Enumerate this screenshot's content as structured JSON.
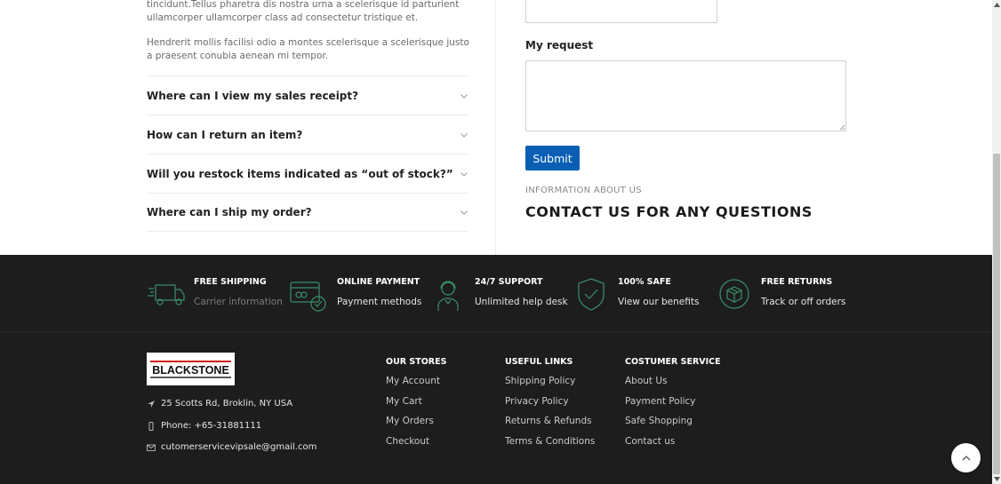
{
  "intro": {
    "paragraph_1": "tincidunt.Tellus pharetra dis nostra urna a scelerisque id parturient ullamcorper ullamcorper class ad consectetur tristique et.",
    "paragraph_2": "Hendrerit mollis facilisi odio a montes scelerisque a scelerisque justo a praesent conubia aenean mi tempor."
  },
  "faq": [
    {
      "question": "Where can I view my sales receipt?"
    },
    {
      "question": "How can I return an item?"
    },
    {
      "question": "Will you restock items indicated as “out of stock?”"
    },
    {
      "question": "Where can I ship my order?"
    }
  ],
  "form": {
    "top_field_value": "",
    "request_label": "My request",
    "request_value": "",
    "submit_label": "Submit",
    "info_label": "INFORMATION ABOUT US",
    "contact_heading": "CONTACT US FOR ANY QUESTIONS"
  },
  "features": [
    {
      "icon": "truck-icon",
      "title": "FREE SHIPPING",
      "subtitle": "Carrier information"
    },
    {
      "icon": "payment-card-icon",
      "title": "ONLINE PAYMENT",
      "subtitle": "Payment methods"
    },
    {
      "icon": "support-agent-icon",
      "title": "24/7 SUPPORT",
      "subtitle": "Unlimited help desk"
    },
    {
      "icon": "shield-check-icon",
      "title": "100% SAFE",
      "subtitle": "View our benefits"
    },
    {
      "icon": "box-return-icon",
      "title": "FREE RETURNS",
      "subtitle": "Track or off orders"
    }
  ],
  "footer": {
    "logo_text": "BLACKSTONE",
    "address": "25 Scotts Rd, Broklin, NY USA",
    "phone": "Phone: +65-31881111",
    "email": "cutomerservicevipsale@gmail.com",
    "columns": [
      {
        "title": "OUR STORES",
        "links": [
          "My Account",
          "My Cart",
          "My Orders",
          "Checkout"
        ]
      },
      {
        "title": "USEFUL LINKS",
        "links": [
          "Shipping Policy",
          "Privacy Policy",
          "Returns & Refunds",
          "Terms & Conditions"
        ]
      },
      {
        "title": "COSTUMER SERVICE",
        "links": [
          "About Us",
          "Payment Policy",
          "Safe Shopping",
          "Contact us"
        ]
      }
    ]
  },
  "colors": {
    "accent": "#0a5fb4",
    "footer_bg": "#1d1d1d",
    "icon_green": "#3a8f6b"
  }
}
